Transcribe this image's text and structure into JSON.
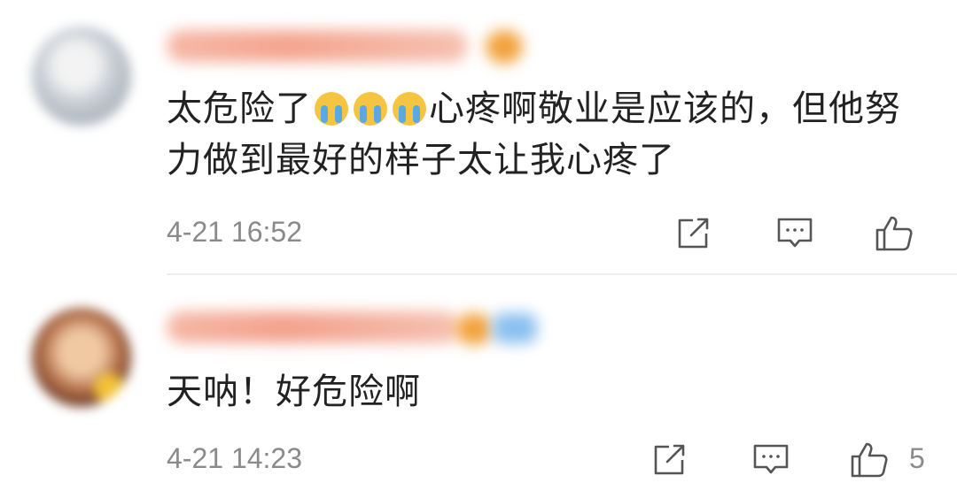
{
  "comments": [
    {
      "text_parts": [
        "太危险了",
        "心疼啊敬业是应该的，但他努力做到最好的样子太让我心疼了"
      ],
      "emoji": [
        "crying-face",
        "crying-face",
        "crying-face"
      ],
      "time": "4-21 16:52",
      "likes": ""
    },
    {
      "text": "天呐！好危险啊",
      "time": "4-21 14:23",
      "likes": "5"
    }
  ],
  "colors": {
    "text": "#222222",
    "meta": "#8a8a8a",
    "divider": "#eeeeee"
  },
  "icons": {
    "share": "share-icon",
    "reply": "comment-icon",
    "like": "thumbs-up-icon"
  }
}
